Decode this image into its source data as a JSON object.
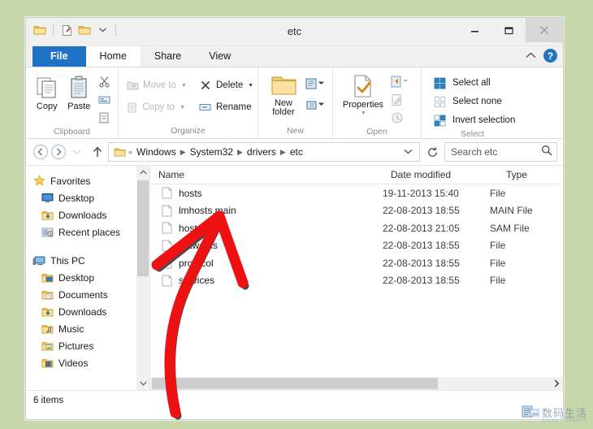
{
  "window": {
    "title": "etc",
    "quick_access": [
      {
        "name": "folder-icon",
        "label": "folder"
      },
      {
        "name": "new-file-icon",
        "label": "new"
      },
      {
        "name": "folder-properties-icon",
        "label": "properties"
      },
      {
        "name": "customize-qat-icon",
        "label": "customize"
      }
    ],
    "controls": {
      "minimize": "minimize",
      "maximize": "maximize",
      "close": "close"
    }
  },
  "ribbon": {
    "tabs": [
      {
        "label": "File",
        "active": false,
        "kind": "file"
      },
      {
        "label": "Home",
        "active": true,
        "kind": "normal"
      },
      {
        "label": "Share",
        "active": false,
        "kind": "normal"
      },
      {
        "label": "View",
        "active": false,
        "kind": "normal"
      }
    ],
    "collapse_label": "^",
    "help_label": "?",
    "groups": [
      {
        "name": "Clipboard",
        "big_buttons": [
          {
            "label": "Copy",
            "enabled": true
          },
          {
            "label": "Paste",
            "enabled": true
          }
        ],
        "small_icons": [
          "cut-icon",
          "copy-path-icon",
          "paste-shortcut-icon"
        ]
      },
      {
        "name": "Organize",
        "items": [
          {
            "label": "Move to",
            "enabled": false,
            "dropdown": true
          },
          {
            "label": "Copy to",
            "enabled": false,
            "dropdown": true
          },
          {
            "label": "Delete",
            "enabled": true,
            "dropdown": true
          },
          {
            "label": "Rename",
            "enabled": true,
            "dropdown": false
          }
        ]
      },
      {
        "name": "New",
        "big_buttons": [
          {
            "label": "New folder",
            "enabled": true
          }
        ],
        "small_icons": [
          "new-item-icon",
          "easy-access-icon"
        ]
      },
      {
        "name": "Open",
        "big_buttons": [
          {
            "label": "Properties",
            "enabled": true
          }
        ],
        "small_icons": [
          "open-icon",
          "edit-icon",
          "history-icon"
        ]
      },
      {
        "name": "Select",
        "items": [
          {
            "label": "Select all",
            "enabled": true
          },
          {
            "label": "Select none",
            "enabled": true
          },
          {
            "label": "Invert selection",
            "enabled": true
          }
        ]
      }
    ]
  },
  "addressbar": {
    "back_label": "back",
    "forward_label": "forward",
    "recent_label": "recent-locations",
    "up_label": "up",
    "overflow": "«",
    "crumbs": [
      "Windows",
      "System32",
      "drivers",
      "etc"
    ],
    "dropdown_label": "history-dropdown",
    "refresh_label": "refresh",
    "search_placeholder": "Search etc"
  },
  "navpane": {
    "sections": [
      {
        "root": {
          "label": "Favorites",
          "icon": "star-icon"
        },
        "items": [
          {
            "label": "Desktop",
            "icon": "desktop-icon"
          },
          {
            "label": "Downloads",
            "icon": "downloads-icon"
          },
          {
            "label": "Recent places",
            "icon": "recent-places-icon"
          }
        ]
      },
      {
        "root": {
          "label": "This PC",
          "icon": "computer-icon"
        },
        "items": [
          {
            "label": "Desktop",
            "icon": "desktop-folder-icon"
          },
          {
            "label": "Documents",
            "icon": "documents-icon"
          },
          {
            "label": "Downloads",
            "icon": "downloads-icon"
          },
          {
            "label": "Music",
            "icon": "music-icon"
          },
          {
            "label": "Pictures",
            "icon": "pictures-icon"
          },
          {
            "label": "Videos",
            "icon": "videos-icon"
          }
        ]
      }
    ]
  },
  "filelist": {
    "columns": [
      {
        "label": "Name",
        "key": "name"
      },
      {
        "label": "Date modified",
        "key": "date"
      },
      {
        "label": "Type",
        "key": "type"
      }
    ],
    "sort_indicator": "ascending",
    "rows": [
      {
        "name": "hosts",
        "date": "19-11-2013 15:40",
        "type": "File",
        "icon": "file-icon"
      },
      {
        "name": "lmhosts.main",
        "date": "22-08-2013 18:55",
        "type": "MAIN File",
        "icon": "file-icon"
      },
      {
        "name": "hosts.sam",
        "date": "22-08-2013 21:05",
        "type": "SAM File",
        "icon": "file-icon"
      },
      {
        "name": "networks",
        "date": "22-08-2013 18:55",
        "type": "File",
        "icon": "file-icon"
      },
      {
        "name": "protocol",
        "date": "22-08-2013 18:55",
        "type": "File",
        "icon": "file-icon"
      },
      {
        "name": "services",
        "date": "22-08-2013 18:55",
        "type": "File",
        "icon": "file-icon"
      }
    ]
  },
  "statusbar": {
    "item_count": "6 items"
  },
  "annotation": {
    "type": "hand-drawn-arrow",
    "color": "#ee1111",
    "outline_color": "#4a4a4a",
    "points_to": "hosts"
  },
  "watermark": {
    "text": "数码生活",
    "subtext": "SHUMA SHENGHUO"
  },
  "colors": {
    "desktop_background": "#c8d6ab",
    "accent": "#1f72c4",
    "folder_yellow": "#f5d06a",
    "window_chrome": "#f0f0f0"
  }
}
